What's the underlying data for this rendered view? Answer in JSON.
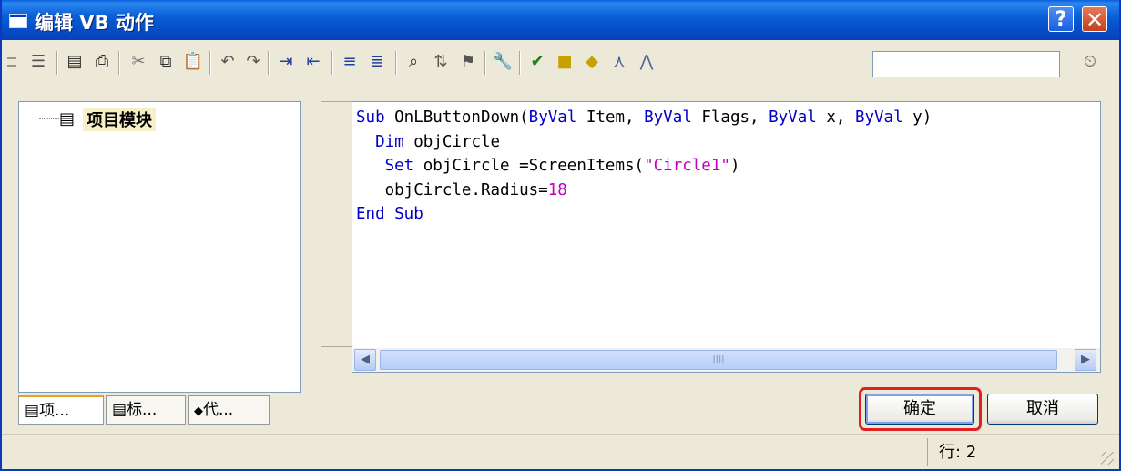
{
  "window": {
    "title": "编辑 VB 动作",
    "help_glyph": "?",
    "close_glyph": "✕"
  },
  "toolbar": {
    "icons": [
      "align-left-icon",
      "format-icon",
      "print-icon",
      "print-preview-icon",
      "cut-icon",
      "copy-icon",
      "paste-icon",
      "undo-icon",
      "redo-icon",
      "indent-icon",
      "outdent-icon",
      "comment-icon",
      "uncomment-icon",
      "bookmark-icon",
      "find-replace-icon",
      "goto-icon",
      "properties-icon",
      "check-syntax-icon",
      "module-icon",
      "module-add-icon",
      "function-icon",
      "project-icon",
      "clock-icon"
    ],
    "search_value": ""
  },
  "tree": {
    "root_label": "项目模块"
  },
  "tabs": [
    {
      "label": "项..."
    },
    {
      "label": "标..."
    },
    {
      "label": "代..."
    }
  ],
  "code_lines": [
    "Sub OnLButtonDown(ByVal Item, ByVal Flags, ByVal x, ByVal y)",
    "  Dim objCircle",
    "   Set objCircle =ScreenItems(\"Circle1\")",
    "   objCircle.Radius=18",
    "End Sub"
  ],
  "code_tokens": {
    "l1_kw": "Sub",
    "l1_name": " OnLButtonDown(",
    "l1_kw2": "ByVal",
    "l1_p1": " Item, ",
    "l1_kw3": "ByVal",
    "l1_p2": " Flags, ",
    "l1_kw4": "ByVal",
    "l1_p3": " x, ",
    "l1_kw5": "ByVal",
    "l1_p4": " y)",
    "l2_indent": "  ",
    "l2_kw": "Dim",
    "l2_rest": " objCircle",
    "l3_indent": "   ",
    "l3_kw": "Set",
    "l3_mid": " objCircle =ScreenItems(",
    "l3_str": "\"Circle1\"",
    "l3_end": ")",
    "l4_indent": "   ",
    "l4_mid": "objCircle.Radius=",
    "l4_num": "18",
    "l5_kw": "End Sub"
  },
  "scrollbar": {
    "left_glyph": "◀",
    "right_glyph": "▶",
    "thumb_grip": "IIII"
  },
  "buttons": {
    "ok_label": "确定",
    "cancel_label": "取消"
  },
  "status": {
    "line_text": "行: 2"
  },
  "colors": {
    "keyword": "#0000c8",
    "string": "#c000c0",
    "title_bar": "#0a5fd8",
    "highlight_ring": "#e02020"
  }
}
